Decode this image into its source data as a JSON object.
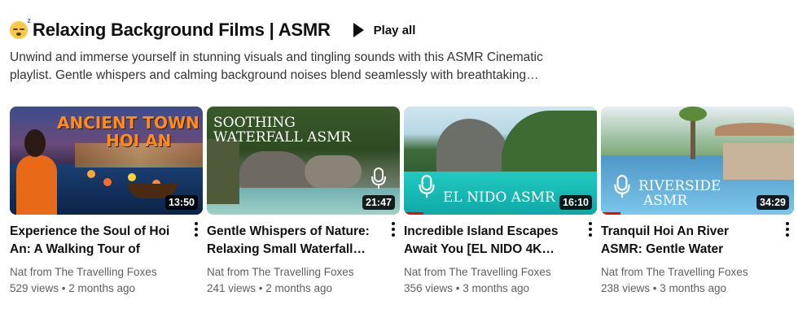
{
  "playlist": {
    "emoji": "sleeping-face-icon",
    "title": "Relaxing Background Films | ASMR",
    "play_all": "Play all",
    "description_line1": "Unwind and immerse yourself in stunning visuals and tingling sounds with this ASMR Cinematic",
    "description_line2": "playlist. Gentle whispers and calming background noises blend seamlessly with breathtaking…"
  },
  "videos": [
    {
      "thumb_text1": "ANCIENT TOWN",
      "thumb_text2": "HOI AN",
      "duration": "13:50",
      "title": "Experience the Soul of Hoi An: A Walking Tour of Sight…",
      "channel": "Nat from The Travelling Foxes",
      "stats": "529 views • 2 months ago"
    },
    {
      "thumb_text1": "SOOTHING",
      "thumb_text2": "WATERFALL ASMR",
      "duration": "21:47",
      "title": "Gentle Whispers of Nature: Relaxing Small Waterfall…",
      "channel": "Nat from The Travelling Foxes",
      "stats": "241 views • 2 months ago"
    },
    {
      "thumb_text1": "EL NIDO ASMR",
      "duration": "16:10",
      "title": "Incredible Island Escapes Await You [EL NIDO 4K…",
      "channel": "Nat from The Travelling Foxes",
      "stats": "356 views • 3 months ago",
      "watched_fraction": 0.1
    },
    {
      "thumb_text1": "RIVERSIDE",
      "thumb_text2": "ASMR",
      "duration": "34:29",
      "title": "Tranquil Hoi An River ASMR: Gentle Water Sounds for…",
      "channel": "Nat from The Travelling Foxes",
      "stats": "238 views • 3 months ago",
      "watched_fraction": 0.1
    }
  ]
}
